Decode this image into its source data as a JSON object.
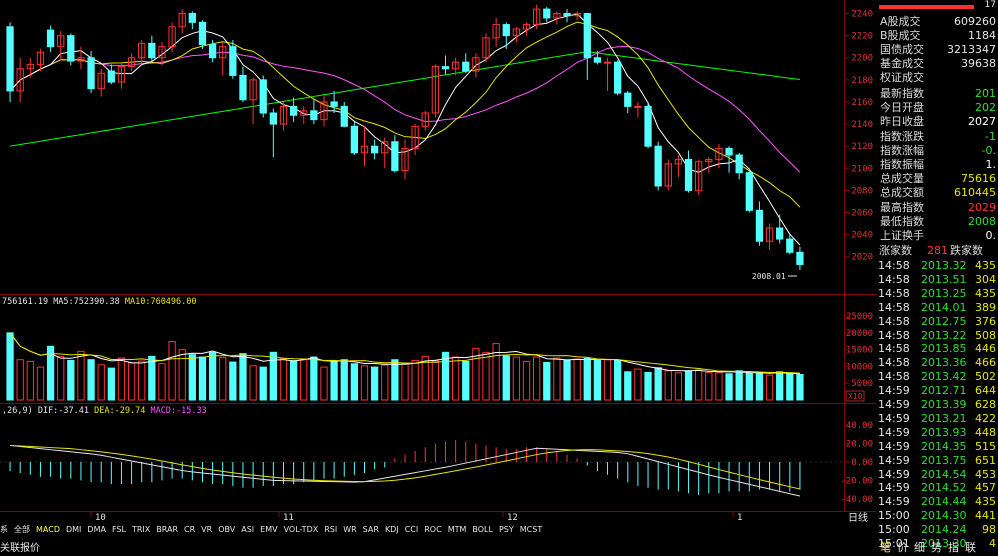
{
  "price_axis": [
    "2240",
    "2220",
    "2200",
    "2180",
    "2160",
    "2140",
    "2120",
    "2100",
    "2080",
    "2060",
    "2040",
    "2020"
  ],
  "annotation_low": "2008.01",
  "volume_header": {
    "vol": "756161.19",
    "ma5_label": "MA5:",
    "ma5": "752390.38",
    "ma10_label": "MA10:",
    "ma10": "760496.00"
  },
  "volume_axis": [
    "25000",
    "20000",
    "15000",
    "10000",
    "5000"
  ],
  "volume_unit": "X10",
  "macd_header": {
    "params": ",26,9)",
    "dif_label": "DIF:",
    "dif": "-37.41",
    "dea_label": "DEA:",
    "dea": "-29.74",
    "macd_label": "MACD:",
    "macd": "-15.33"
  },
  "macd_axis": [
    "40.00",
    "20.00",
    "0.00",
    "-20.00",
    "-40.00"
  ],
  "x_labels": [
    "10",
    "11",
    "12",
    "1"
  ],
  "period_label": "日线",
  "arrows": "◄ ►",
  "indicator_tabs": [
    "全部",
    "MACD",
    "DMI",
    "DMA",
    "FSL",
    "TRIX",
    "BRAR",
    "CR",
    "VR",
    "OBV",
    "ASI",
    "EMV",
    "VOL-TDX",
    "RSI",
    "WR",
    "SAR",
    "KDJ",
    "CCI",
    "ROC",
    "MTM",
    "BOLL",
    "PSY",
    "MCST"
  ],
  "indicator_selected": "MACD",
  "left_tab_first": "系",
  "bottom_left": "关联报价",
  "right_panel": {
    "top_number": "17",
    "market_rows": [
      {
        "label": "A股成交",
        "value": "609260"
      },
      {
        "label": "B股成交",
        "value": "1184"
      },
      {
        "label": "国债成交",
        "value": "3213347"
      },
      {
        "label": "基金成交",
        "value": "39638"
      },
      {
        "label": "权证成交",
        "value": ""
      }
    ],
    "index_rows": [
      {
        "label": "最新指数",
        "value": "201",
        "color": "#33dd33"
      },
      {
        "label": "今日开盘",
        "value": "202",
        "color": "#33dd33"
      },
      {
        "label": "昨日收盘",
        "value": "2027",
        "color": "#ffffff"
      },
      {
        "label": "指数涨跌",
        "value": "-1",
        "color": "#33dd33"
      },
      {
        "label": "指数涨幅",
        "value": "-0.",
        "color": "#33dd33"
      },
      {
        "label": "指数振幅",
        "value": "1.",
        "color": "#ffffff"
      },
      {
        "label": "总成交量",
        "value": "75616",
        "color": "#e6e600"
      },
      {
        "label": "总成交额",
        "value": "610445",
        "color": "#e6e600"
      },
      {
        "label": "最高指数",
        "value": "2029",
        "color": "#ff3333"
      },
      {
        "label": "最低指数",
        "value": "2008",
        "color": "#33dd33"
      },
      {
        "label": "上证换手",
        "value": "0.",
        "color": "#ffffff"
      }
    ],
    "updown": {
      "up_label": "涨家数",
      "up": "281",
      "down_label": "跌家数"
    },
    "ticks": [
      {
        "t": "14:58",
        "p": "2013.32",
        "v": "435"
      },
      {
        "t": "14:58",
        "p": "2013.51",
        "v": "304"
      },
      {
        "t": "14:58",
        "p": "2013.25",
        "v": "435"
      },
      {
        "t": "14:58",
        "p": "2014.01",
        "v": "389"
      },
      {
        "t": "14:58",
        "p": "2012.75",
        "v": "376"
      },
      {
        "t": "14:58",
        "p": "2013.22",
        "v": "508"
      },
      {
        "t": "14:58",
        "p": "2013.85",
        "v": "446"
      },
      {
        "t": "14:58",
        "p": "2013.36",
        "v": "466"
      },
      {
        "t": "14:58",
        "p": "2013.42",
        "v": "502"
      },
      {
        "t": "14:59",
        "p": "2012.71",
        "v": "644"
      },
      {
        "t": "14:59",
        "p": "2013.39",
        "v": "628"
      },
      {
        "t": "14:59",
        "p": "2013.21",
        "v": "422"
      },
      {
        "t": "14:59",
        "p": "2013.93",
        "v": "448"
      },
      {
        "t": "14:59",
        "p": "2014.35",
        "v": "515"
      },
      {
        "t": "14:59",
        "p": "2013.75",
        "v": "651"
      },
      {
        "t": "14:59",
        "p": "2014.54",
        "v": "453"
      },
      {
        "t": "14:59",
        "p": "2014.52",
        "v": "457"
      },
      {
        "t": "14:59",
        "p": "2014.44",
        "v": "435"
      },
      {
        "t": "15:00",
        "p": "2014.30",
        "v": "441"
      },
      {
        "t": "15:00",
        "p": "2014.24",
        "v": "98"
      },
      {
        "t": "15:01",
        "p": "2013.30",
        "v": "4"
      }
    ],
    "bottom_tabs": [
      "笔",
      "价",
      "细",
      "势",
      "指",
      "联"
    ],
    "bottom_selected": "笔"
  },
  "colors": {
    "up": "#ff3232",
    "down": "#54ffff",
    "ma5": "#ffffff",
    "ma10": "#e6e600",
    "ma20": "#ff55ff",
    "ma60": "#00ff00",
    "grid": "#8b0000",
    "macd_pos": "#ff3232",
    "macd_neg": "#54ffff"
  },
  "chart_data": {
    "type": "candlestick",
    "x_labels": [
      "10",
      "11",
      "12",
      "1"
    ],
    "y_range": [
      2008,
      2245
    ],
    "candles_ohlc": [
      [
        2228,
        2232,
        2160,
        2170
      ],
      [
        2170,
        2200,
        2160,
        2190
      ],
      [
        2190,
        2200,
        2182,
        2194
      ],
      [
        2194,
        2208,
        2188,
        2205
      ],
      [
        2225,
        2229,
        2205,
        2210
      ],
      [
        2210,
        2224,
        2198,
        2220
      ],
      [
        2220,
        2222,
        2193,
        2197
      ],
      [
        2197,
        2210,
        2190,
        2200
      ],
      [
        2200,
        2206,
        2168,
        2172
      ],
      [
        2172,
        2190,
        2165,
        2186
      ],
      [
        2188,
        2194,
        2176,
        2178
      ],
      [
        2178,
        2196,
        2172,
        2192
      ],
      [
        2192,
        2204,
        2188,
        2200
      ],
      [
        2200,
        2216,
        2194,
        2213
      ],
      [
        2213,
        2220,
        2196,
        2200
      ],
      [
        2200,
        2214,
        2193,
        2210
      ],
      [
        2210,
        2232,
        2205,
        2228
      ],
      [
        2228,
        2244,
        2222,
        2240
      ],
      [
        2240,
        2242,
        2226,
        2232
      ],
      [
        2232,
        2234,
        2208,
        2212
      ],
      [
        2212,
        2216,
        2196,
        2200
      ],
      [
        2200,
        2214,
        2184,
        2210
      ],
      [
        2210,
        2216,
        2181,
        2184
      ],
      [
        2184,
        2192,
        2160,
        2162
      ],
      [
        2162,
        2182,
        2140,
        2180
      ],
      [
        2180,
        2184,
        2146,
        2150
      ],
      [
        2150,
        2154,
        2110,
        2140
      ],
      [
        2140,
        2160,
        2134,
        2156
      ],
      [
        2156,
        2164,
        2142,
        2148
      ],
      [
        2148,
        2156,
        2140,
        2152
      ],
      [
        2152,
        2162,
        2140,
        2144
      ],
      [
        2144,
        2166,
        2138,
        2160
      ],
      [
        2160,
        2170,
        2150,
        2156
      ],
      [
        2156,
        2160,
        2137,
        2138
      ],
      [
        2138,
        2142,
        2112,
        2114
      ],
      [
        2114,
        2138,
        2102,
        2120
      ],
      [
        2120,
        2126,
        2108,
        2114
      ],
      [
        2114,
        2128,
        2100,
        2124
      ],
      [
        2124,
        2130,
        2096,
        2098
      ],
      [
        2098,
        2126,
        2090,
        2118
      ],
      [
        2118,
        2140,
        2112,
        2138
      ],
      [
        2138,
        2152,
        2134,
        2150
      ],
      [
        2150,
        2194,
        2146,
        2192
      ],
      [
        2192,
        2202,
        2185,
        2190
      ],
      [
        2190,
        2200,
        2184,
        2196
      ],
      [
        2196,
        2204,
        2186,
        2188
      ],
      [
        2188,
        2204,
        2182,
        2200
      ],
      [
        2200,
        2222,
        2196,
        2218
      ],
      [
        2218,
        2236,
        2210,
        2230
      ],
      [
        2230,
        2232,
        2208,
        2220
      ],
      [
        2220,
        2228,
        2214,
        2226
      ],
      [
        2226,
        2232,
        2220,
        2230
      ],
      [
        2230,
        2248,
        2226,
        2244
      ],
      [
        2244,
        2246,
        2232,
        2236
      ],
      [
        2236,
        2242,
        2230,
        2240
      ],
      [
        2240,
        2244,
        2232,
        2238
      ],
      [
        2238,
        2242,
        2234,
        2240
      ],
      [
        2240,
        2240,
        2180,
        2200
      ],
      [
        2200,
        2206,
        2194,
        2196
      ],
      [
        2196,
        2200,
        2170,
        2196
      ],
      [
        2196,
        2198,
        2166,
        2168
      ],
      [
        2168,
        2170,
        2150,
        2156
      ],
      [
        2156,
        2160,
        2146,
        2156
      ],
      [
        2156,
        2160,
        2118,
        2120
      ],
      [
        2120,
        2124,
        2080,
        2084
      ],
      [
        2084,
        2108,
        2080,
        2104
      ],
      [
        2104,
        2112,
        2092,
        2108
      ],
      [
        2108,
        2116,
        2078,
        2080
      ],
      [
        2080,
        2108,
        2076,
        2106
      ],
      [
        2106,
        2110,
        2096,
        2108
      ],
      [
        2108,
        2122,
        2100,
        2118
      ],
      [
        2118,
        2120,
        2096,
        2112
      ],
      [
        2112,
        2114,
        2090,
        2096
      ],
      [
        2096,
        2100,
        2060,
        2062
      ],
      [
        2062,
        2070,
        2030,
        2034
      ],
      [
        2034,
        2050,
        2026,
        2046
      ],
      [
        2046,
        2058,
        2032,
        2036
      ],
      [
        2036,
        2040,
        2022,
        2024
      ],
      [
        2024,
        2029,
        2008,
        2013
      ]
    ],
    "volume": [
      20000,
      12000,
      11500,
      9800,
      16000,
      13000,
      11800,
      14500,
      12000,
      10500,
      9500,
      12500,
      11000,
      11600,
      13000,
      10800,
      17400,
      15000,
      13500,
      12800,
      14200,
      12600,
      11300,
      13800,
      10200,
      9800,
      14200,
      12200,
      11700,
      12000,
      12800,
      9800,
      11600,
      12000,
      10800,
      10200,
      9800,
      10400,
      12000,
      10800,
      11800,
      13000,
      11600,
      14200,
      12800,
      11500,
      15400,
      14200,
      16800,
      13100,
      12800,
      11500,
      12800,
      11200,
      12500,
      11800,
      12200,
      12400,
      11800,
      12000,
      11900,
      8400,
      9200,
      8200,
      9600,
      8700,
      8100,
      8700,
      9000,
      8200,
      8100,
      7800,
      8700,
      7900,
      8100,
      7400,
      8400,
      7800,
      7600
    ],
    "macd_hist": [
      -5,
      -6,
      -7,
      -8,
      -8,
      -9,
      -9,
      -10,
      -11,
      -11,
      -12,
      -12,
      -12,
      -11,
      -11,
      -10,
      -9,
      -9,
      -10,
      -11,
      -12,
      -12,
      -13,
      -14,
      -14,
      -13,
      -13,
      -12,
      -12,
      -11,
      -10,
      -9,
      -9,
      -8,
      -7,
      -6,
      -4,
      -3,
      2,
      4,
      6,
      8,
      10,
      11,
      12,
      11,
      10,
      9,
      8,
      7,
      7,
      8,
      8,
      7,
      6,
      4,
      2,
      -2,
      -5,
      -7,
      -9,
      -11,
      -13,
      -14,
      -15,
      -15,
      -16,
      -17,
      -18,
      -17,
      -17,
      -16,
      -16,
      -16,
      -15,
      -15,
      -16,
      -16,
      -15
    ],
    "dif_end": -37.41,
    "dea_end": -29.74,
    "macd_end": -15.33
  }
}
